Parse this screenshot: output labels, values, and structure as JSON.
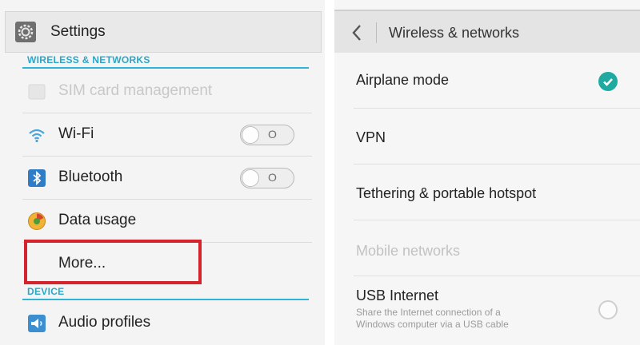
{
  "left": {
    "header": {
      "title": "Settings",
      "icon": "settings-gear-icon"
    },
    "sections": {
      "wireless": "WIRELESS & NETWORKS",
      "device": "DEVICE"
    },
    "items": {
      "sim": {
        "label": "SIM card management",
        "icon": "sim-card-icon",
        "enabled": false
      },
      "wifi": {
        "label": "Wi-Fi",
        "icon": "wifi-icon",
        "toggle": "O"
      },
      "bluetooth": {
        "label": "Bluetooth",
        "icon": "bluetooth-icon",
        "toggle": "O"
      },
      "data": {
        "label": "Data usage",
        "icon": "data-usage-icon"
      },
      "more": {
        "label": "More..."
      },
      "audio": {
        "label": "Audio profiles",
        "icon": "audio-profiles-icon"
      }
    }
  },
  "right": {
    "header": {
      "title": "Wireless & networks",
      "icon": "back-arrow-icon"
    },
    "items": {
      "airplane": {
        "label": "Airplane mode",
        "checked": true
      },
      "vpn": {
        "label": "VPN"
      },
      "tethering": {
        "label": "Tethering & portable hotspot"
      },
      "mobile": {
        "label": "Mobile networks",
        "enabled": false
      },
      "usb": {
        "label": "USB Internet",
        "sub1": "Share the Internet connection of a",
        "sub2": "Windows computer via a USB cable",
        "checked": false
      }
    }
  },
  "colors": {
    "accent": "#2fb4d6",
    "highlight": "#d5232e",
    "check": "#1ea9a1"
  }
}
